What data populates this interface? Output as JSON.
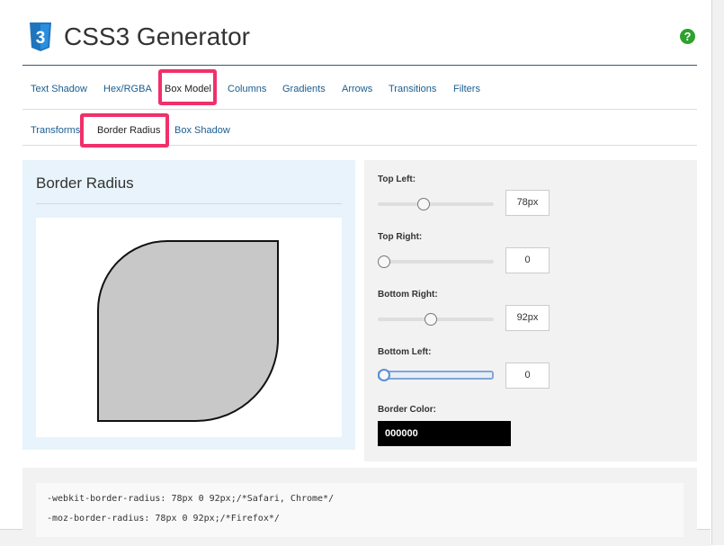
{
  "header": {
    "title": "CSS3 Generator",
    "logo_text": "3",
    "help_icon_label": "?"
  },
  "main_tabs": [
    {
      "label": "Text Shadow"
    },
    {
      "label": "Hex/RGBA"
    },
    {
      "label": "Box Model"
    },
    {
      "label": "Columns"
    },
    {
      "label": "Gradients"
    },
    {
      "label": "Arrows"
    },
    {
      "label": "Transitions"
    },
    {
      "label": "Filters"
    }
  ],
  "sub_tabs": [
    {
      "label": "Transforms"
    },
    {
      "label": "Border Radius"
    },
    {
      "label": "Box Shadow"
    }
  ],
  "preview": {
    "title": "Border Radius"
  },
  "controls": {
    "top_left": {
      "label": "Top Left:",
      "value": "78px"
    },
    "top_right": {
      "label": "Top Right:",
      "value": "0"
    },
    "bottom_right": {
      "label": "Bottom Right:",
      "value": "92px"
    },
    "bottom_left": {
      "label": "Bottom Left:",
      "value": "0"
    },
    "border_color": {
      "label": "Border Color:",
      "value": "000000"
    }
  },
  "code": {
    "lines": [
      "-webkit-border-radius: 78px 0 92px;/*Safari, Chrome*/",
      "-moz-border-radius: 78px 0 92px;/*Firefox*/"
    ]
  },
  "colors": {
    "link": "#1a5d8f",
    "highlight": "#f0306a",
    "help": "#2ea12e",
    "css3_logo": "#1f75bd"
  }
}
